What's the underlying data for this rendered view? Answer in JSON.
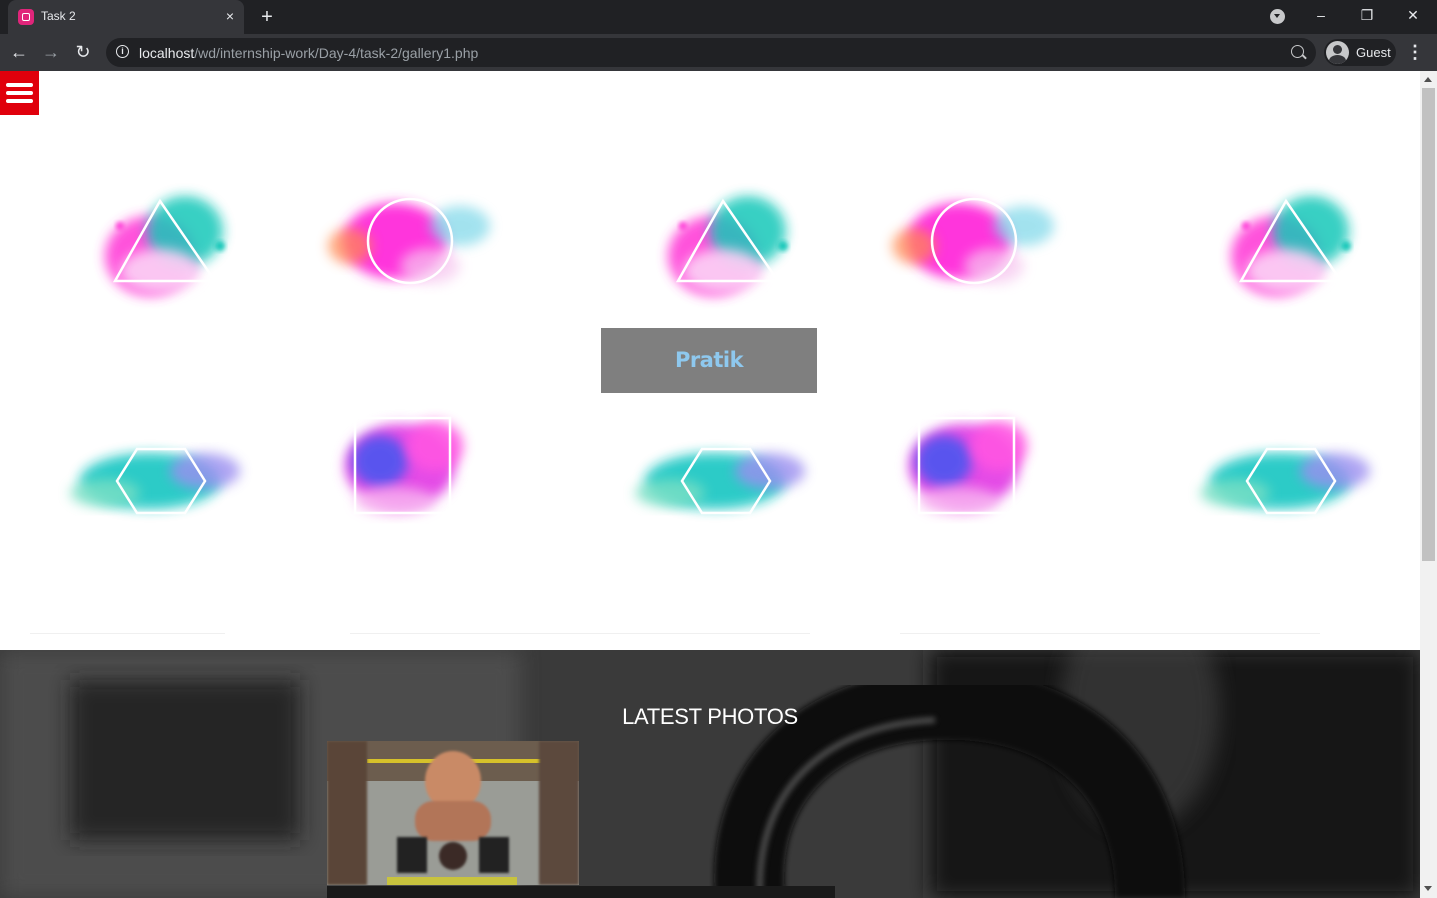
{
  "browser": {
    "tab_title": "Task 2",
    "tab_close": "×",
    "new_tab": "+",
    "url_host": "localhost",
    "url_path": "/wd/internship-work/Day-4/task-2/gallery1.php",
    "profile_label": "Guest",
    "window_min": "–",
    "window_restore": "❐",
    "window_close": "✕",
    "icons": {
      "back": "←",
      "forward": "→",
      "reload": "↻",
      "info": "i",
      "menu": "⋮"
    }
  },
  "page": {
    "brand": "Pratik",
    "latest_photos_title": "LATEST PHOTOS",
    "colors": {
      "menu_red": "#e0000c",
      "brand_box": "#7f7f7f",
      "brand_text": "#8ec8ee"
    }
  }
}
